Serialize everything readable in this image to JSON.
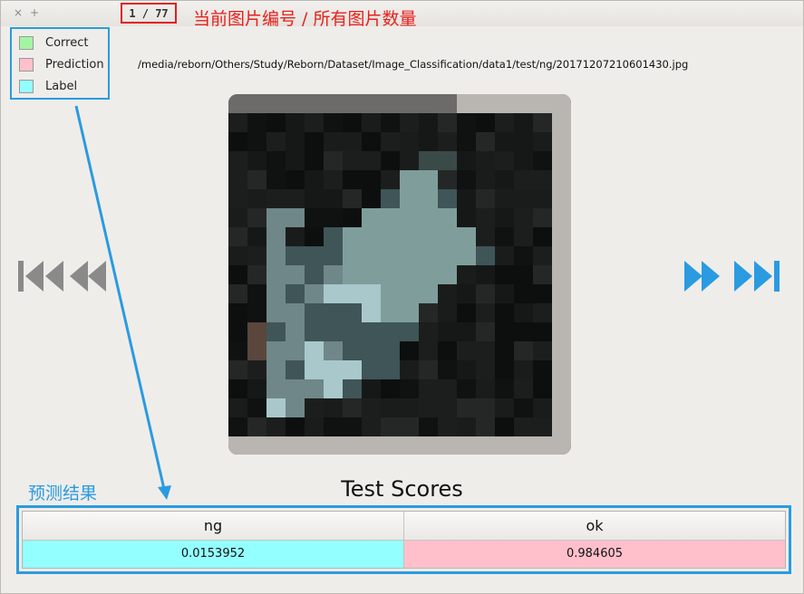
{
  "window": {
    "close_glyph": "×",
    "max_glyph": "+"
  },
  "counter": {
    "text": "1 / 77",
    "annotation": "当前图片编号 / 所有图片数量"
  },
  "legend": {
    "items": [
      {
        "label": "Correct",
        "color": "#a3f5a3"
      },
      {
        "label": "Prediction",
        "color": "#ffc0cb"
      },
      {
        "label": "Label",
        "color": "#94ffff"
      }
    ]
  },
  "file_path": "/media/reborn/Others/Study/Reborn/Dataset/Image_Classification/data1/test/ng/20171207210601430.jpg",
  "nav": {
    "first_icon": "skip-to-first-icon",
    "prev_icon": "rewind-icon",
    "next_icon": "fast-forward-icon",
    "last_icon": "skip-to-last-icon",
    "prev_color": "#8a8a8a",
    "next_color": "#2a9be0"
  },
  "prediction_annotation": "预测结果",
  "scores": {
    "title": "Test Scores",
    "columns": [
      "ng",
      "ok"
    ],
    "values": [
      "0.0153952",
      "0.984605"
    ],
    "cell_colors": [
      "#94ffff",
      "#ffc0cb"
    ]
  },
  "colors": {
    "annotation_blue": "#2a9be0",
    "annotation_red": "#e8201c"
  }
}
